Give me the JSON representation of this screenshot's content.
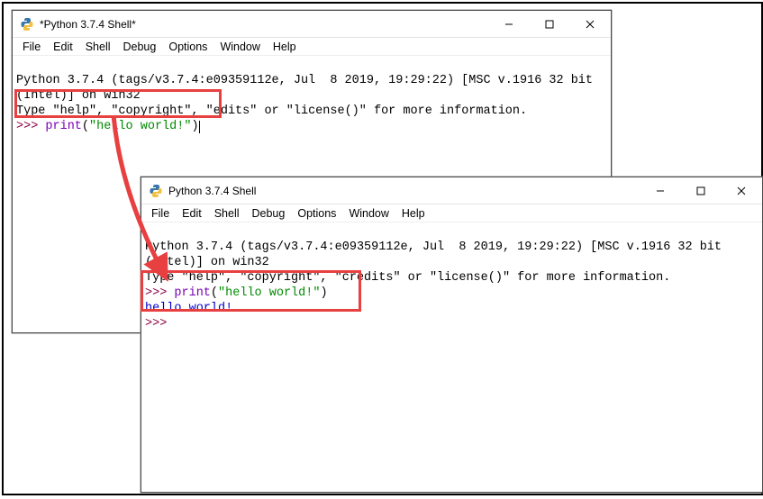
{
  "window1": {
    "title": "*Python 3.7.4 Shell*",
    "menu": [
      "File",
      "Edit",
      "Shell",
      "Debug",
      "Options",
      "Window",
      "Help"
    ],
    "line1": "Python 3.7.4 (tags/v3.7.4:e09359112e, Jul  8 2019, 19:29:22) [MSC v.1916 32 bit",
    "line2": "(Intel)] on win32",
    "line3a": "Type \"help\", \"copyright\", \"",
    "line3b": "edits\" or \"license()\" for more information.",
    "prompt": ">>> ",
    "code_kw": "print",
    "code_paren1": "(",
    "code_str": "\"hello world!\"",
    "code_paren2": ")"
  },
  "window2": {
    "title": "Python 3.7.4 Shell",
    "menu": [
      "File",
      "Edit",
      "Shell",
      "Debug",
      "Options",
      "Window",
      "Help"
    ],
    "line1": "Python 3.7.4 (tags/v3.7.4:e09359112e, Jul  8 2019, 19:29:22) [MSC v.1916 32 bit",
    "line2": "(Intel)] on win32",
    "line3": "Type \"help\", \"copyright\", \"credits\" or \"license()\" for more information.",
    "prompt": ">>> ",
    "code_kw": "print",
    "code_paren1": "(",
    "code_str": "\"hello world!\"",
    "code_paren2": ")",
    "output": "hello world!",
    "prompt2": ">>> "
  },
  "colors": {
    "highlight": "#e84040",
    "prompt": "#8b0045",
    "keyword": "#7b00b5",
    "string": "#008b00",
    "output": "#0000cc"
  }
}
